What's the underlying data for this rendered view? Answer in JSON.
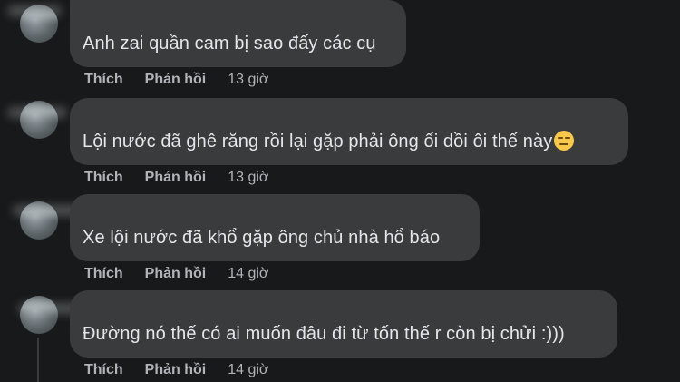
{
  "comments": [
    {
      "text": "Anh zai quần cam bị sao đấy các cụ",
      "like_label": "Thích",
      "reply_label": "Phản hồi",
      "time": "13 giờ"
    },
    {
      "text": "Lội nước đã ghê răng rồi lại gặp phải ông ối dồi ôi thế này",
      "emoji": "expressionless-face-icon",
      "like_label": "Thích",
      "reply_label": "Phản hồi",
      "time": "13 giờ"
    },
    {
      "text": "Xe lội nước đã khổ gặp ông chủ nhà hổ báo",
      "like_label": "Thích",
      "reply_label": "Phản hồi",
      "time": "14 giờ"
    },
    {
      "text": "Đường nó thế có ai muốn đâu đi từ tốn thế r còn bị chửi :)))",
      "like_label": "Thích",
      "reply_label": "Phản hồi",
      "time": "14 giờ"
    }
  ],
  "colors": {
    "background": "#18191a",
    "bubble": "#3a3b3c",
    "text": "#e4e6eb",
    "secondary_text": "#b0b3b8"
  }
}
